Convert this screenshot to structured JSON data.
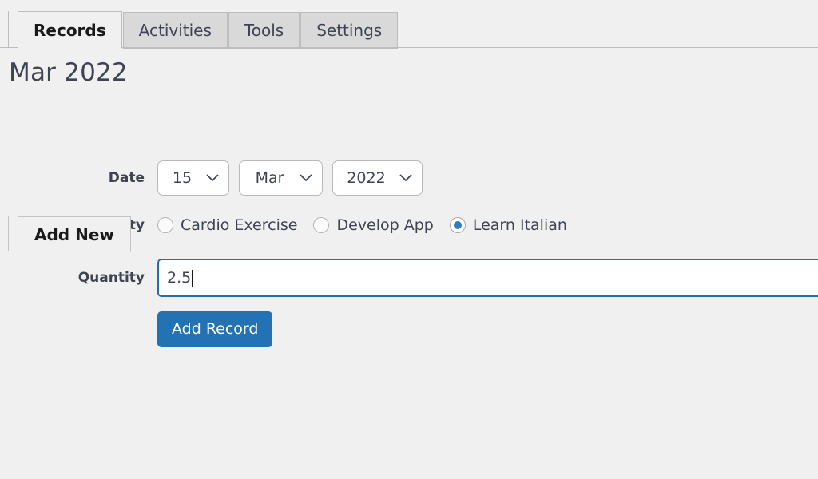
{
  "tabs": [
    {
      "label": "Records",
      "active": true
    },
    {
      "label": "Activities",
      "active": false
    },
    {
      "label": "Tools",
      "active": false
    },
    {
      "label": "Settings",
      "active": false
    }
  ],
  "page": {
    "title": "Mar 2022"
  },
  "subtabs": [
    {
      "label": "Add New",
      "active": true
    }
  ],
  "form": {
    "date": {
      "label": "Date",
      "day": {
        "value": "15"
      },
      "month": {
        "value": "Mar"
      },
      "year": {
        "value": "2022"
      }
    },
    "activity": {
      "label": "Activity",
      "options": [
        {
          "label": "Cardio Exercise",
          "checked": false
        },
        {
          "label": "Develop App",
          "checked": false
        },
        {
          "label": "Learn Italian",
          "checked": true
        }
      ]
    },
    "quantity": {
      "label": "Quantity",
      "value": "2.5",
      "placeholder": ""
    },
    "submit": {
      "label": "Add Record"
    }
  },
  "colors": {
    "page_background": "#f0f0f0",
    "tab_inactive_background": "#d9d9d9",
    "tab_active_background": "#f0f0f0",
    "border": "#bdbdbd",
    "label_text": "#3c4551",
    "accent": "#2272b4",
    "focus_border": "#1f6fb2",
    "radio_selected": "#2d7dc4"
  }
}
